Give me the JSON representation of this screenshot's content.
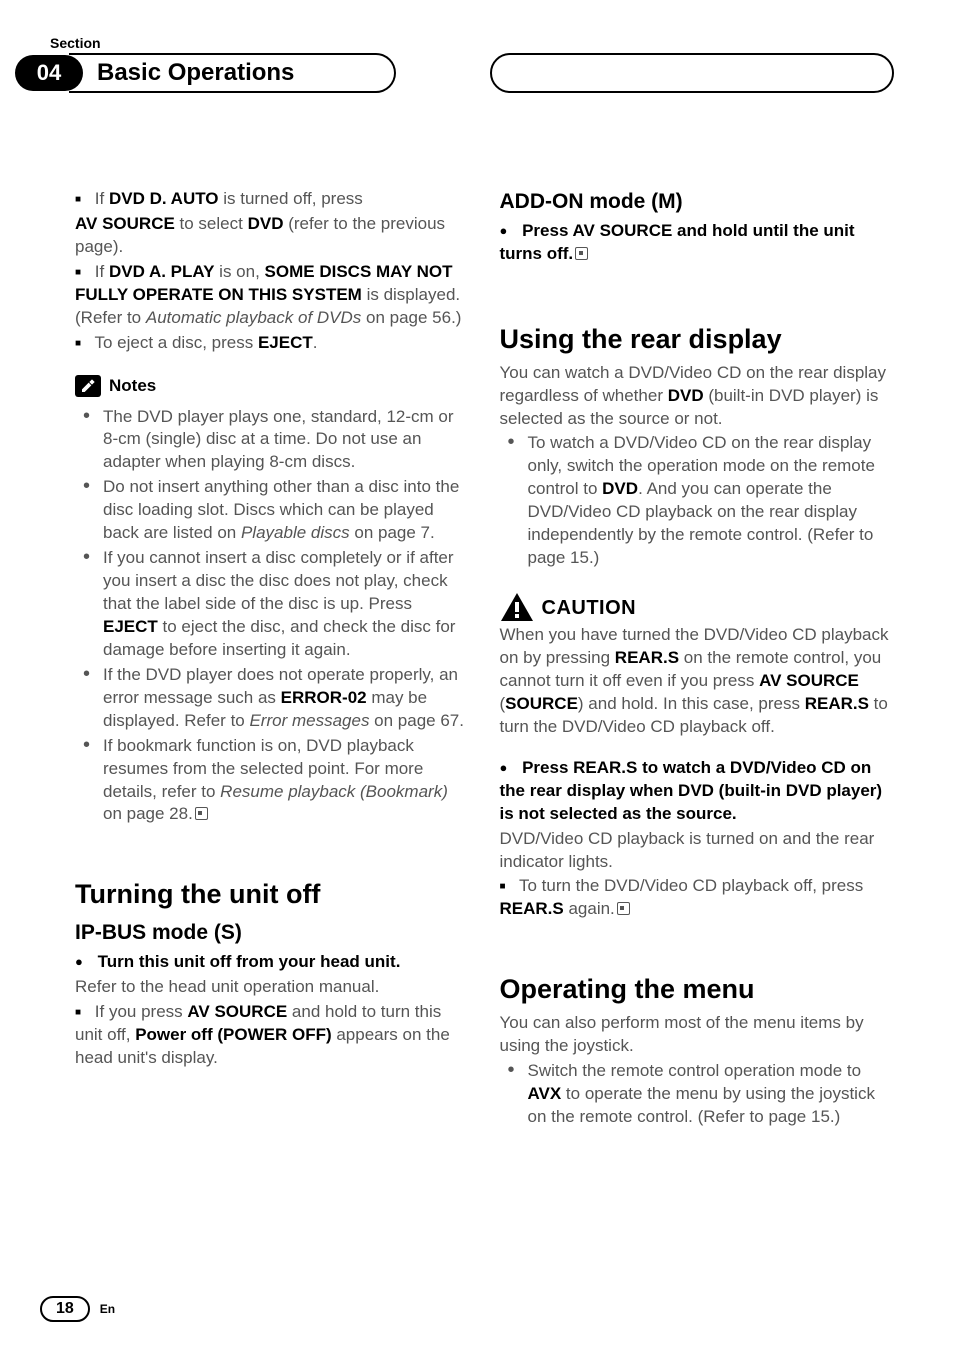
{
  "header": {
    "section_label": "Section",
    "section_number": "04",
    "title": "Basic Operations"
  },
  "left": {
    "p1_pre": "If ",
    "p1_bold1": "DVD D. AUTO",
    "p1_mid": " is turned off, press",
    "p2_bold1": "AV SOURCE",
    "p2_mid": " to select ",
    "p2_bold2": "DVD",
    "p2_end": " (refer to the previous page).",
    "p3_pre": "If ",
    "p3_bold1": "DVD A. PLAY",
    "p3_mid": " is on, ",
    "p3_bold2": "SOME DISCS MAY NOT FULLY OPERATE ON THIS SYSTEM",
    "p3_mid2": " is displayed. (Refer to ",
    "p3_ital": "Automatic playback of DVDs",
    "p3_end": " on page 56.)",
    "p4_pre": "To eject a disc, press ",
    "p4_bold": "EJECT",
    "p4_end": ".",
    "notes_label": "Notes",
    "n1": "The DVD player plays one, standard, 12-cm or 8-cm (single) disc at a time. Do not use an adapter when playing 8-cm discs.",
    "n2_a": "Do not insert anything other than a disc into the disc loading slot. Discs which can be played back are listed on ",
    "n2_i": "Playable discs",
    "n2_b": " on page 7.",
    "n3_a": "If you cannot insert a disc completely or if after you insert a disc the disc does not play, check that the label side of the disc is up. Press ",
    "n3_bold": "EJECT",
    "n3_b": " to eject the disc, and check the disc for damage before inserting it again.",
    "n4_a": "If the DVD player does not operate properly, an error message such as ",
    "n4_bold": "ERROR-02",
    "n4_b": " may be displayed. Refer to ",
    "n4_i": "Error messages",
    "n4_c": " on page 67.",
    "n5_a": "If bookmark function is on, DVD playback resumes from the selected point. For more details, refer to ",
    "n5_i": "Resume playback (Bookmark)",
    "n5_b": " on page 28.",
    "turnoff_h": "Turning the unit off",
    "ipbus_h": "IP-BUS mode (S)",
    "ip1": "Turn this unit off from your head unit.",
    "ip2": "Refer to the head unit operation manual.",
    "ip3_a": "If you press ",
    "ip3_bold1": "AV SOURCE",
    "ip3_b": " and hold to turn this unit off, ",
    "ip3_bold2": "Power off (POWER OFF)",
    "ip3_c": " appears on the head unit's display."
  },
  "right": {
    "addon_h": "ADD-ON mode (M)",
    "addon_l1": "Press AV SOURCE and hold until the unit turns off.",
    "rear_h": "Using the rear display",
    "rear_p1_a": "You can watch a DVD/Video CD on the rear display regardless of whether ",
    "rear_p1_bold": "DVD",
    "rear_p1_b": " (built-in DVD player) is selected as the source or not.",
    "rear_li_a": "To watch a DVD/Video CD on the rear display only, switch the operation mode on the remote control to ",
    "rear_li_bold": "DVD",
    "rear_li_b": ". And you can operate the DVD/Video CD playback on the rear display independently by the remote control. (Refer to page 15.)",
    "caution_label": "CAUTION",
    "caution_p_a": "When you have turned the DVD/Video CD playback on by pressing ",
    "caution_bold1": "REAR.S",
    "caution_p_b": " on the remote control, you cannot turn it off even if you press ",
    "caution_bold2": "AV SOURCE",
    "caution_p_c": " (",
    "caution_bold3": "SOURCE",
    "caution_p_d": ") and hold. In this case, press ",
    "caution_bold4": "REAR.S",
    "caution_p_e": " to turn the DVD/Video CD playback off.",
    "rear2_l1": "Press REAR.S to watch a DVD/Video CD on the rear display when DVD (built-in DVD player) is not selected as the source.",
    "rear2_l2": "DVD/Video CD playback is turned on and the rear indicator lights.",
    "rear2_l3_a": "To turn the DVD/Video CD playback off, press ",
    "rear2_bold": "REAR.S",
    "rear2_l3_b": " again.",
    "menu_h": "Operating the menu",
    "menu_p1": "You can also perform most of the menu items by using the joystick.",
    "menu_li_a": "Switch the remote control operation mode to ",
    "menu_bold": "AVX",
    "menu_li_b": " to operate the menu by using the joystick on the remote control. (Refer to page 15.)"
  },
  "footer": {
    "page": "18",
    "lang": "En"
  }
}
